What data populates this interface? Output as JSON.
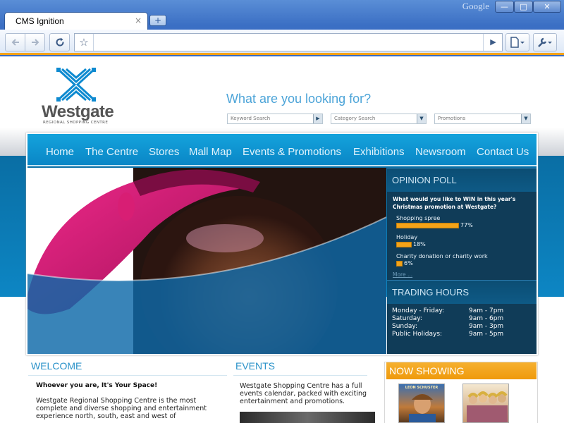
{
  "browser": {
    "brand": "Google",
    "tab_title": "CMS Ignition",
    "tab_close_glyph": "×",
    "new_tab_glyph": "+",
    "window_buttons": {
      "minimize": "—",
      "maximize": "□",
      "close": "✕"
    },
    "icons": {
      "back": "back-arrow-icon",
      "forward": "forward-arrow-icon",
      "reload": "reload-icon",
      "star": "bookmark-star-icon",
      "go": "go-arrow-icon",
      "page": "page-menu-icon",
      "wrench": "wrench-menu-icon"
    },
    "accent": "#f4a318"
  },
  "site": {
    "logo": {
      "name": "Westgate",
      "tagline": "REGIONAL SHOPPING CENTRE"
    },
    "search": {
      "heading": "What are you looking for?",
      "keyword_placeholder": "Keyword Search",
      "category_placeholder": "Category Search",
      "promotions_placeholder": "Promotions"
    },
    "nav": [
      "Home",
      "The Centre",
      "Stores",
      "Mall Map",
      "Events & Promotions",
      "Exhibitions",
      "Newsroom",
      "Contact Us"
    ],
    "poll": {
      "title": "OPINION POLL",
      "question": "What would you like to WIN in this year's Christmas promotion at Westgate?",
      "options": [
        {
          "label": "Shopping spree",
          "percent": 77,
          "percent_text": "77%"
        },
        {
          "label": "Holiday",
          "percent": 18,
          "percent_text": "18%"
        },
        {
          "label": "Charity donation or charity work",
          "percent": 6,
          "percent_text": "6%"
        }
      ],
      "more": "More ..."
    },
    "hours": {
      "title": "TRADING HOURS",
      "rows": [
        {
          "day": "Monday - Friday:",
          "time": "9am - 7pm"
        },
        {
          "day": "Saturday:",
          "time": "9am - 6pm"
        },
        {
          "day": "Sunday:",
          "time": "9am - 3pm"
        },
        {
          "day": "Public Holidays:",
          "time": "9am - 5pm"
        }
      ]
    },
    "welcome": {
      "title": "WELCOME",
      "lead": "Whoever you are, It's Your Space!",
      "body_lines": [
        "Westgate Regional Shopping Centre is the most",
        "complete and diverse shopping and entertainment",
        "experience north, south, east and west of"
      ]
    },
    "events": {
      "title": "EVENTS",
      "body_lines": [
        "Westgate Shopping Centre has a full",
        "events calendar, packed with exciting",
        "entertainment and promotions."
      ]
    },
    "now_showing": {
      "title": "NOW SHOWING",
      "posters": [
        {
          "caption": "LEON SCHUSTER"
        },
        {
          "caption": ""
        }
      ]
    },
    "colors": {
      "nav_blue": "#0a86c6",
      "sidebar_navy": "#103c58",
      "orange": "#f4a318",
      "heading_blue": "#2a92c9"
    }
  }
}
